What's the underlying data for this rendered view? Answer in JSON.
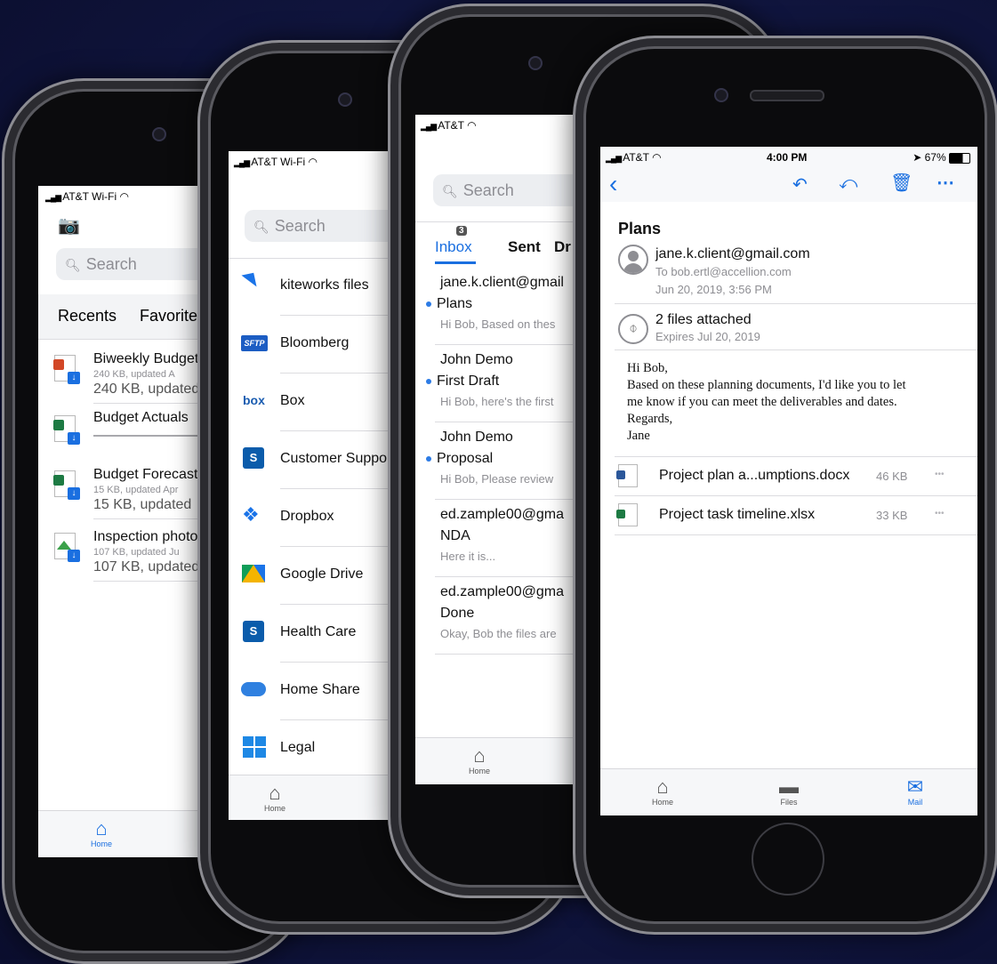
{
  "phone1": {
    "status": {
      "carrier": "AT&T Wi-Fi"
    },
    "search_placeholder": "Search",
    "tabs": [
      {
        "label": "Recents"
      },
      {
        "label": "Favorites"
      }
    ],
    "files": [
      {
        "name": "Biweekly Budget",
        "meta_small": "240 KB, updated A",
        "meta": "240 KB, updated"
      },
      {
        "name": "Budget Actuals",
        "meta_small": "",
        "meta": ""
      },
      {
        "name": "Budget Forecast",
        "meta_small": "15 KB, updated Apr",
        "meta": "15 KB, updated"
      },
      {
        "name": "Inspection photo",
        "meta_small": "107 KB, updated Ju",
        "meta": "107 KB, updated"
      }
    ],
    "tabbar": {
      "home": "Home"
    }
  },
  "phone2": {
    "status": {
      "carrier": "AT&T Wi-Fi"
    },
    "search_placeholder": "Search",
    "sources": [
      {
        "label": "kiteworks files",
        "icon": "kiteworks-icon"
      },
      {
        "label": "Bloomberg",
        "icon": "sftp-icon"
      },
      {
        "label": "Box",
        "icon": "box-icon"
      },
      {
        "label": "Customer Support",
        "icon": "sharepoint-icon"
      },
      {
        "label": "Dropbox",
        "icon": "dropbox-icon"
      },
      {
        "label": "Google Drive",
        "icon": "google-drive-icon"
      },
      {
        "label": "Health Care",
        "icon": "sharepoint-icon"
      },
      {
        "label": "Home Share",
        "icon": "cloud-icon"
      },
      {
        "label": "Legal",
        "icon": "windows-icon"
      }
    ],
    "sftp_badge": "SFTP",
    "box_badge": "box",
    "tabbar": {
      "home": "Home"
    }
  },
  "phone3": {
    "status": {
      "carrier": "AT&T"
    },
    "search_placeholder": "Search",
    "tabs": [
      {
        "label": "Inbox",
        "badge": "3"
      },
      {
        "label": "Sent"
      },
      {
        "label": "Dr"
      }
    ],
    "messages": [
      {
        "from": "jane.k.client@gmail",
        "subject": "Plans",
        "preview": "Hi Bob, Based on thes",
        "unread": true
      },
      {
        "from": "John Demo",
        "subject": "First Draft",
        "preview": "Hi Bob, here's the first",
        "unread": true
      },
      {
        "from": "John Demo",
        "subject": "Proposal",
        "preview": "Hi Bob, Please review",
        "unread": true
      },
      {
        "from": "ed.zample00@gma",
        "subject": "NDA",
        "preview": "Here it is...",
        "unread": false
      },
      {
        "from": "ed.zample00@gma",
        "subject": "Done",
        "preview": "Okay, Bob the files are",
        "unread": false
      }
    ],
    "tabbar": {
      "home": "Home"
    }
  },
  "phone4": {
    "status": {
      "carrier": "AT&T",
      "time": "4:00 PM",
      "battery": "67%"
    },
    "subject": "Plans",
    "from": "jane.k.client@gmail.com",
    "to": "To bob.ertl@accellion.com",
    "date": "Jun 20, 2019, 3:56 PM",
    "attach_count": "2 files attached",
    "expires": "Expires Jul 20, 2019",
    "body": [
      "Hi Bob,",
      "Based on these planning documents, I'd like you to let",
      "me know if you can meet the deliverables and dates.",
      "Regards,",
      "Jane"
    ],
    "attachments": [
      {
        "name": "Project plan a...umptions.docx",
        "size": "46 KB",
        "type": "word"
      },
      {
        "name": "Project task timeline.xlsx",
        "size": "33 KB",
        "type": "excel"
      }
    ],
    "more_glyph": "•••",
    "tabbar": {
      "home": "Home",
      "files": "Files",
      "mail": "Mail"
    }
  }
}
